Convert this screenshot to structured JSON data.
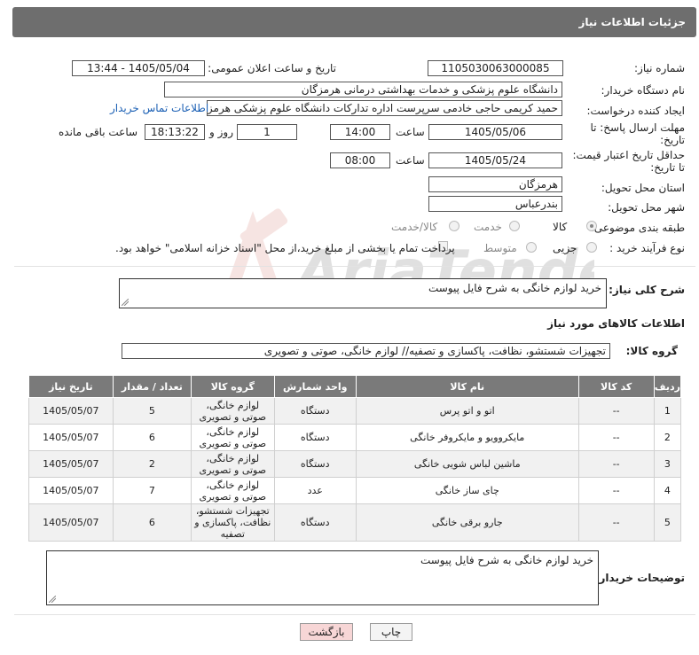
{
  "header": {
    "title": "جزئیات اطلاعات نیاز"
  },
  "watermark": {
    "text": "AriaTender.net"
  },
  "fields": {
    "need_number": {
      "label": "شماره نیاز:",
      "value": "1105030063000085"
    },
    "announce_datetime": {
      "label": "تاریخ و ساعت اعلان عمومی:",
      "value": "1405/05/04 - 13:44"
    },
    "buyer_org": {
      "label": "نام دستگاه خریدار:",
      "value": "دانشگاه علوم پزشکی و خدمات بهداشتی درمانی هرمزگان"
    },
    "requester": {
      "label": "ایجاد کننده درخواست:",
      "value": "حمید کریمی حاجی خادمی سرپرست اداره تدارکات دانشگاه علوم پزشکی هرمزگان",
      "contact_link": "اطلاعات تماس خریدار"
    },
    "reply_deadline": {
      "label_line1": "مهلت ارسال پاسخ: تا",
      "label_line2": "تاریخ:",
      "date": "1405/05/06",
      "time_label": "ساعت",
      "time": "14:00",
      "days": "1",
      "days_label": "روز و",
      "remaining": "18:13:22",
      "remaining_label": "ساعت باقی مانده"
    },
    "price_validity": {
      "label_line1": "حداقل تاریخ اعتبار قیمت:",
      "label_line2": "تا تاریخ:",
      "date": "1405/05/24",
      "time_label": "ساعت",
      "time": "08:00"
    },
    "delivery_province": {
      "label": "استان محل تحویل:",
      "value": "هرمزگان"
    },
    "delivery_city": {
      "label": "شهر محل تحویل:",
      "value": "بندرعباس"
    },
    "category": {
      "label": "طبقه بندی موضوعی:",
      "options": [
        "کالا",
        "خدمت",
        "کالا/خدمت"
      ],
      "selected": "کالا"
    },
    "purchase_process": {
      "label": "نوع فرآیند خرید :",
      "options": [
        "جزیی",
        "متوسط"
      ],
      "payment_note": "پرداخت تمام یا بخشی از مبلغ خرید،از محل \"اسناد خزانه اسلامی\" خواهد بود."
    }
  },
  "description": {
    "label": "شرح کلی نیاز:",
    "value": "خرید لوازم خانگی به شرح فایل پیوست"
  },
  "goods_section": {
    "title": "اطلاعات کالاهای مورد نیاز",
    "group_label": "گروه کالا:",
    "group_value": "تجهیزات شستشو، نظافت، پاکسازی و تصفیه// لوازم خانگی، صوتی و تصویری"
  },
  "table": {
    "headers": [
      "ردیف",
      "کد کالا",
      "نام کالا",
      "واحد شمارش",
      "گروه کالا",
      "تعداد / مقدار",
      "تاریخ نیاز"
    ],
    "rows": [
      {
        "row": "1",
        "code": "--",
        "name": "اتو و اتو پرس",
        "unit": "دستگاه",
        "group": "لوازم خانگی، صوتی و تصویری",
        "qty": "5",
        "date": "1405/05/07"
      },
      {
        "row": "2",
        "code": "--",
        "name": "مایکروویو و مایکروفر خانگی",
        "unit": "دستگاه",
        "group": "لوازم خانگی، صوتی و تصویری",
        "qty": "6",
        "date": "1405/05/07"
      },
      {
        "row": "3",
        "code": "--",
        "name": "ماشین لباس شویی خانگی",
        "unit": "دستگاه",
        "group": "لوازم خانگی، صوتی و تصویری",
        "qty": "2",
        "date": "1405/05/07"
      },
      {
        "row": "4",
        "code": "--",
        "name": "چای ساز خانگی",
        "unit": "عدد",
        "group": "لوازم خانگی، صوتی و تصویری",
        "qty": "7",
        "date": "1405/05/07"
      },
      {
        "row": "5",
        "code": "--",
        "name": "جارو برقی خانگی",
        "unit": "دستگاه",
        "group": "تجهیزات شستشو، نظافت، پاکسازی و تصفیه",
        "qty": "6",
        "date": "1405/05/07"
      }
    ]
  },
  "buyer_notes": {
    "label": "توضیحات خریدار:",
    "value": "خرید لوازم خانگی به شرح فایل پیوست"
  },
  "buttons": {
    "print": "چاپ",
    "back": "بازگشت"
  },
  "colors": {
    "header_bg": "#6e6e6e",
    "link": "#1a5fb4",
    "back_button": "#f7d6d6"
  }
}
